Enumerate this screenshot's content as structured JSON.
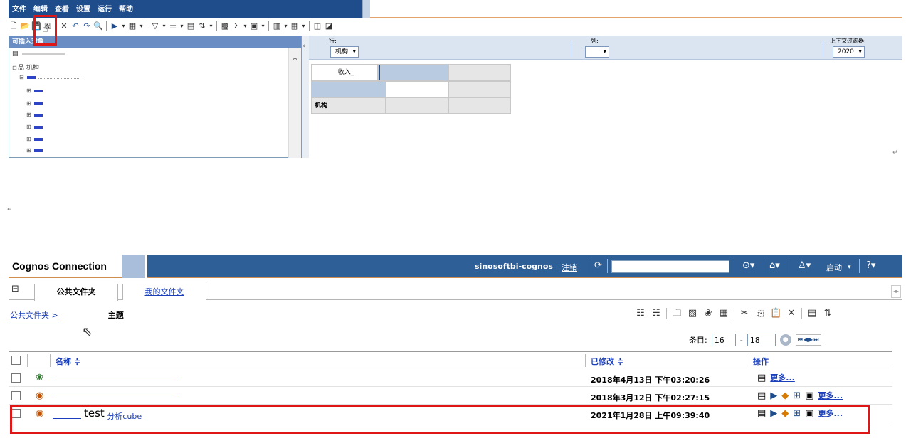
{
  "studio": {
    "menu": [
      "文件",
      "编辑",
      "查看",
      "设置",
      "运行",
      "帮助"
    ],
    "toolbar_icons": [
      "new-icon",
      "open-icon",
      "save-icon",
      "save-as-icon",
      "delete-icon",
      "undo-icon",
      "redo-icon",
      "find-icon",
      "run-icon",
      "crosstab-icon",
      "filter-icon",
      "suppress-icon",
      "rank-icon",
      "sort-icon",
      "chart-icon",
      "sum-icon",
      "calculate-icon",
      "bar-chart-icon",
      "column-chart-icon",
      "explore-icon",
      "swap-icon"
    ],
    "insertable_objects_title": "可插入对象",
    "tree_items": [
      "机构"
    ],
    "rows_label": "行:",
    "rows_chip": "机构",
    "columns_label": "列:",
    "context_filter_label": "上下文过滤器:",
    "context_filter_value": "2020",
    "crosstab_header_measure": "收入_",
    "crosstab_row_label": "机构"
  },
  "connection": {
    "title": "Cognos Connection",
    "username": "sinosoftbi-cognos",
    "logout": "注销",
    "launch": "启动",
    "tabs": [
      "公共文件夹",
      "我的文件夹"
    ],
    "breadcrumb_root": "公共文件夹 >",
    "breadcrumb_current": "主题",
    "pager_label": "条目:",
    "pager_from": "16",
    "pager_dash": "-",
    "pager_to": "18",
    "headers": {
      "name": "名称 ≑",
      "modified": "已修改 ≑",
      "actions": "操作"
    },
    "rows": [
      {
        "name": "",
        "modified": "2018年4月13日 下午03:20:26",
        "more": "更多..."
      },
      {
        "name": "",
        "modified": "2018年3月12日 下午02:27:15",
        "more": "更多..."
      },
      {
        "name_big": "test",
        "name_suffix": "分析cube",
        "modified": "2021年1月28日 上午09:39:40",
        "more": "更多..."
      }
    ]
  },
  "colors": {
    "brand_blue": "#2f5f97",
    "highlight_red": "#e01515",
    "accent_orange": "#cf8d50"
  }
}
